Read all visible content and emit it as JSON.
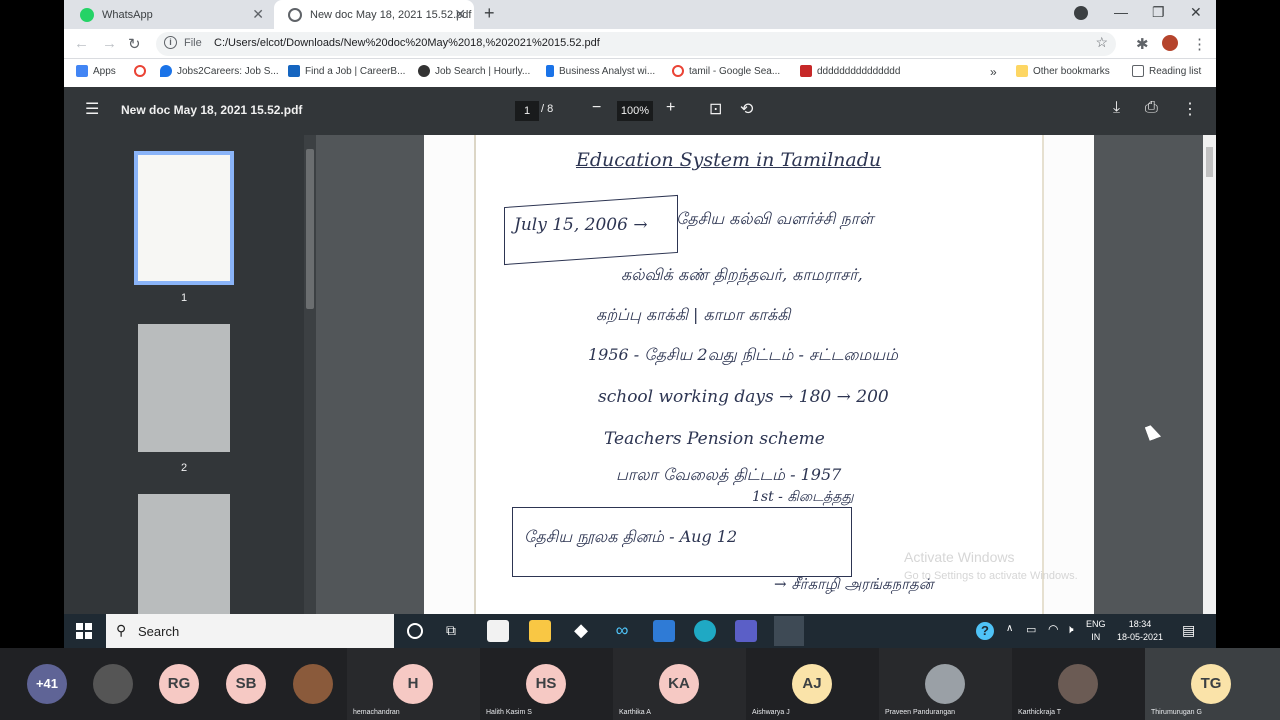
{
  "browser": {
    "tabs": [
      {
        "label": "WhatsApp"
      },
      {
        "label": "New doc May 18, 2021 15.52.pdf"
      }
    ],
    "address": {
      "scheme": "File",
      "url": "C:/Users/elcot/Downloads/New%20doc%20May%2018,%202021%2015.52.pdf"
    },
    "bookmarks": [
      {
        "label": "Apps"
      },
      {
        "label": "Jobs2Careers: Job S..."
      },
      {
        "label": "Find a Job | CareerB..."
      },
      {
        "label": "Job Search | Hourly..."
      },
      {
        "label": "Business Analyst wi..."
      },
      {
        "label": "tamil - Google Sea..."
      },
      {
        "label": "ddddddddddddddd"
      }
    ],
    "other_bookmarks": "Other bookmarks",
    "reading_list": "Reading list",
    "more": "»"
  },
  "pdf": {
    "title": "New doc May 18, 2021 15.52.pdf",
    "page": "1",
    "total": "/  8",
    "zoom": "100%",
    "thumbs": [
      "1",
      "2"
    ]
  },
  "document": {
    "lines": [
      "Education  System  in  Tamilnadu",
      "July 15, 2006 →",
      "தேசிய கல்வி வளர்ச்சி நாள்",
      "கல்விக் கண் திறந்தவர், காமராசர்,",
      "கற்ப்பு காக்கி | காமா காக்கி",
      "1956 - தேசிய 2வது நிட்டம் - சட்டமையம்",
      "school working days → 180 → 200",
      "Teachers Pension scheme",
      "பாலா வேலைத் திட்டம் - 1957",
      "1st - கிடைத்தது",
      "தேசிய நூலக தினம்  -  Aug 12",
      "→ சீர்காழி அரங்கநாதன்"
    ]
  },
  "os": {
    "watermark_title": "Activate Windows",
    "watermark_sub": "Go to Settings to activate Windows.",
    "search": "Search",
    "lang": "ENG",
    "region": "IN",
    "time": "18:34",
    "date": "18-05-2021"
  },
  "call": {
    "more_count": "+41",
    "participants": [
      {
        "initials": "RG",
        "color": "#f6c9c4"
      },
      {
        "initials": "SB",
        "color": "#f6c9c4"
      },
      {
        "initials": "H",
        "name": "hemachandran",
        "color": "#f6c9c4"
      },
      {
        "initials": "HS",
        "name": "Halith Kasim S",
        "color": "#f6c9c4"
      },
      {
        "initials": "KA",
        "name": "Karthika A",
        "color": "#f6c9c4"
      },
      {
        "initials": "AJ",
        "name": "Aishwarya J",
        "color": "#fae3a9"
      },
      {
        "name": "Praveen Pandurangan"
      },
      {
        "name": "Karthickraja T"
      },
      {
        "initials": "TG",
        "name": "Thirumurugan G",
        "color": "#fae3a9"
      }
    ]
  }
}
